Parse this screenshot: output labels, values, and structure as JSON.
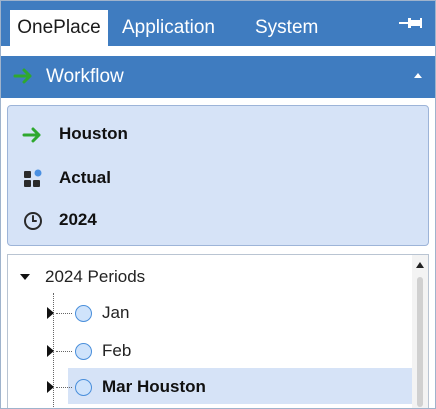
{
  "tabs": [
    {
      "label": "OnePlace",
      "active": true
    },
    {
      "label": "Application",
      "active": false
    },
    {
      "label": "System",
      "active": false
    }
  ],
  "workflow_header": {
    "title": "Workflow"
  },
  "info_panel": {
    "entity": "Houston",
    "scenario": "Actual",
    "time": "2024"
  },
  "tree": {
    "root": "2024 Periods",
    "children": [
      "Jan",
      "Feb",
      "Mar Houston"
    ],
    "selected": "Mar Houston"
  },
  "colors": {
    "accent": "#3f7cc0",
    "panel_bg": "#d6e3f7",
    "arrow_green": "#2fa82f"
  }
}
